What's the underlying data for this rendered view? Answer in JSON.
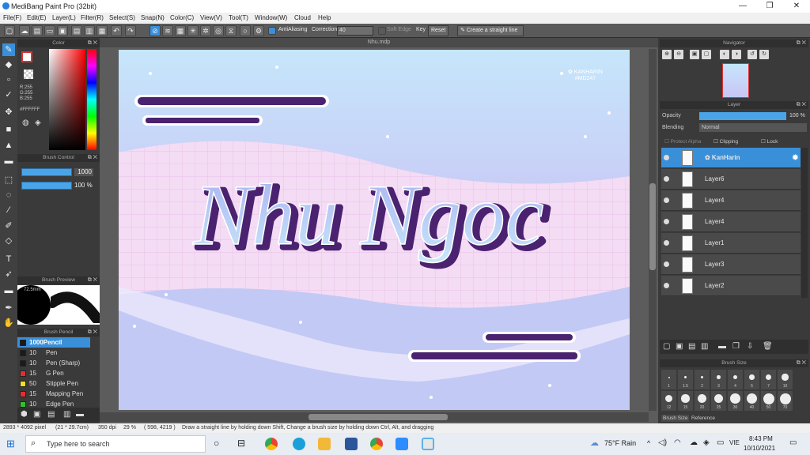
{
  "window": {
    "title": "MediBang Paint Pro (32bit)",
    "minimize": "—",
    "maximize": "❐",
    "close": "✕"
  },
  "menu": [
    "File(F)",
    "Edit(E)",
    "Layer(L)",
    "Filter(R)",
    "Select(S)",
    "Snap(N)",
    "Color(C)",
    "View(V)",
    "Tool(T)",
    "Window(W)",
    "Cloud",
    "Help"
  ],
  "toolbar": {
    "antialiasing": "AntiAliasing",
    "correction_label": "Correction",
    "correction_value": "40",
    "soft_edge": "Soft Edge",
    "key": "Key",
    "reset": "Reset",
    "straight_line": "Create a straight line"
  },
  "color_panel": {
    "title": "Color",
    "r": "R:255",
    "g": "G:255",
    "b": "B:255",
    "hex": "#FFFFFF"
  },
  "brush_control": {
    "title": "Brush Control",
    "size": "1000",
    "opacity": "100 %"
  },
  "brush_preview": {
    "title": "Brush Preview",
    "size_label": "72.5mm"
  },
  "brush_panel": {
    "title": "Brush Pencil",
    "items": [
      {
        "size": "1000",
        "name": "Pencil",
        "color": "#1a1a1a",
        "selected": true
      },
      {
        "size": "10",
        "name": "Pen",
        "color": "#1a1a1a"
      },
      {
        "size": "10",
        "name": "Pen (Sharp)",
        "color": "#1a1a1a"
      },
      {
        "size": "15",
        "name": "G Pen",
        "color": "#e03030"
      },
      {
        "size": "50",
        "name": "Stipple Pen",
        "color": "#f0e020"
      },
      {
        "size": "15",
        "name": "Mapping Pen",
        "color": "#e03030"
      },
      {
        "size": "10",
        "name": "Edge Pen",
        "color": "#30c030"
      }
    ]
  },
  "document": {
    "tab": "Nhu.mdp",
    "art_title": "Nhu Ngoc",
    "watermark_1": "✿ KANHARIN",
    "watermark_2": "#MD247"
  },
  "navigator": {
    "title": "Navigator"
  },
  "layer_panel": {
    "title": "Layer",
    "opacity_label": "Opacity",
    "opacity_value": "100 %",
    "opacity": 1.0,
    "blending_label": "Blending",
    "blending_value": "Normal",
    "protect_alpha": "Protect Alpha",
    "clipping": "Clipping",
    "lock": "Lock",
    "layers": [
      "✿ KanHarin",
      "Layer6",
      "Layer4",
      "Layer4",
      "Layer1",
      "Layer3",
      "Layer2"
    ]
  },
  "brush_size": {
    "title": "Brush Size",
    "sizes": [
      "1",
      "1.5",
      "2",
      "3",
      "4",
      "5",
      "7",
      "10",
      "12",
      "15",
      "20",
      "25",
      "30",
      "40",
      "50",
      "70"
    ],
    "tab1": "Brush Size",
    "tab2": "Reference"
  },
  "status": {
    "dims": "2893 * 4092 pixel",
    "cm": "(21 * 29.7cm)",
    "dpi": "350 dpi",
    "zoom": "29 %",
    "coords": "( 598, 4219 )",
    "hint": "Draw a straight line by holding down Shift, Change a brush size by holding down Ctrl, Alt, and dragging"
  },
  "taskbar": {
    "search": "Type here to search",
    "weather": "75°F Rain",
    "lang": "VIE",
    "time": "8:43 PM",
    "date": "10/10/2021"
  },
  "colors": {
    "accent": "#3a8fd9",
    "art_purple": "#4a2270",
    "letter_fill": "#b8b6f4"
  }
}
